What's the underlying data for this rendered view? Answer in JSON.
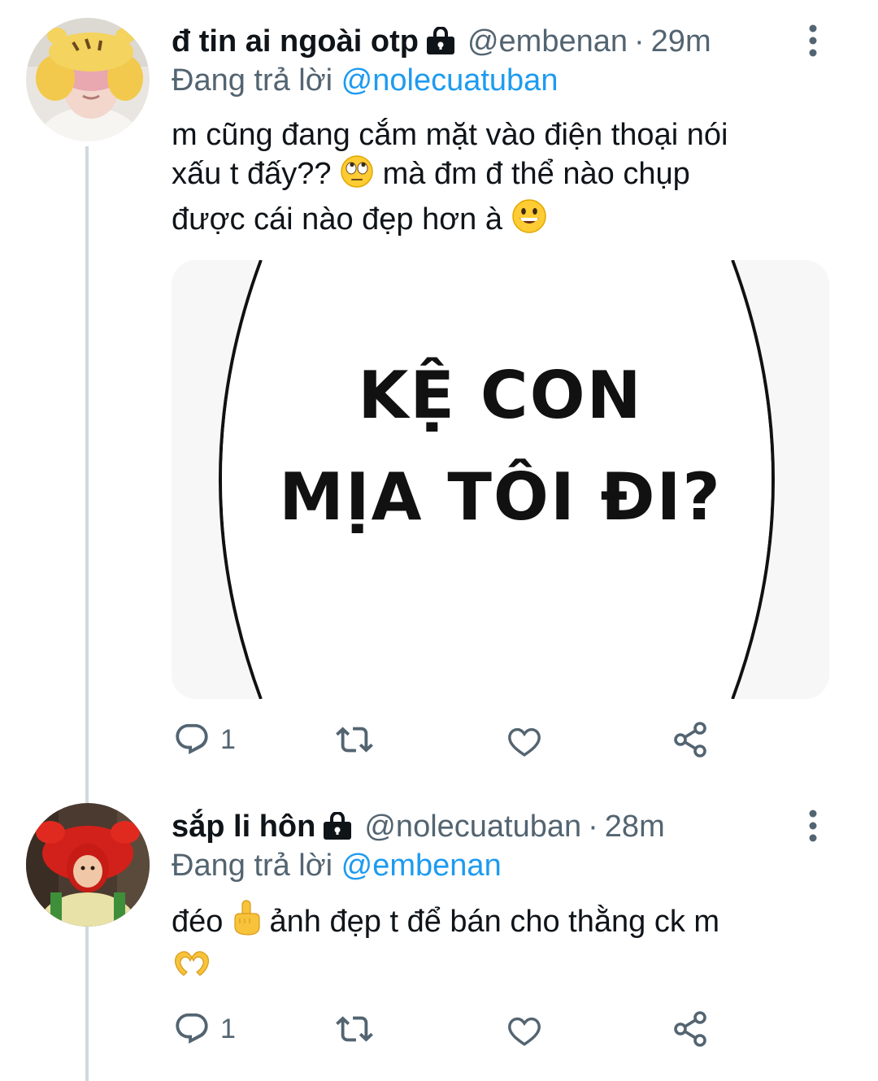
{
  "tweets": [
    {
      "display_name": "đ tin ai ngoài otp",
      "handle": "@embenan",
      "separator": "·",
      "time": "29m",
      "reply_prefix": "Đang trả lời",
      "reply_to": "@nolecuatuban",
      "text_line1": "m cũng đang cắm mặt vào điện thoại nói",
      "text_line2_a": "xấu t đấy??",
      "text_line2_b": "mà đm đ thể nào chụp",
      "text_line3": "được cái nào đẹp hơn à",
      "emoji_1": "face-with-rolling-eyes",
      "emoji_2": "grinning-face",
      "media": {
        "line1": "KỆ CON",
        "line2": "MỊA TÔI ĐI?"
      },
      "reply_count": "1"
    },
    {
      "display_name": "sắp li hôn",
      "handle": "@nolecuatuban",
      "separator": "·",
      "time": "28m",
      "reply_prefix": "Đang trả lời",
      "reply_to": "@embenan",
      "text_a": "đéo",
      "text_b": "ảnh đẹp t để bán cho thằng ck m",
      "emoji_1": "middle-finger",
      "emoji_2": "heart-hands",
      "reply_count": "1"
    }
  ],
  "colors": {
    "text": "#0f1419",
    "secondary": "#536471",
    "link": "#1d9bf0",
    "thread_line": "#cfd9de"
  }
}
